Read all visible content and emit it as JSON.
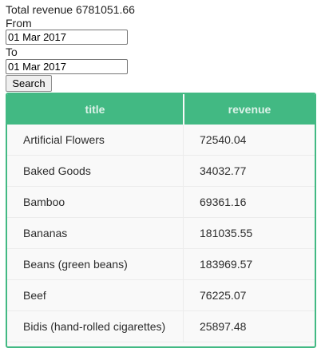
{
  "summary": {
    "label": "Total revenue",
    "value": "6781051.66"
  },
  "filters": {
    "from_label": "From",
    "from_value": "01 Mar 2017",
    "to_label": "To",
    "to_value": "01 Mar 2017",
    "search_label": "Search"
  },
  "table": {
    "columns": [
      "title",
      "revenue"
    ],
    "rows": [
      {
        "title": "Artificial Flowers",
        "revenue": "72540.04"
      },
      {
        "title": "Baked Goods",
        "revenue": "34032.77"
      },
      {
        "title": "Bamboo",
        "revenue": "69361.16"
      },
      {
        "title": "Bananas",
        "revenue": "181035.55"
      },
      {
        "title": "Beans (green beans)",
        "revenue": "183969.57"
      },
      {
        "title": "Beef",
        "revenue": "76225.07"
      },
      {
        "title": "Bidis (hand-rolled cigarettes)",
        "revenue": "25897.48"
      }
    ]
  },
  "colors": {
    "accent": "#42b983",
    "row_background": "#f9f9f9"
  }
}
